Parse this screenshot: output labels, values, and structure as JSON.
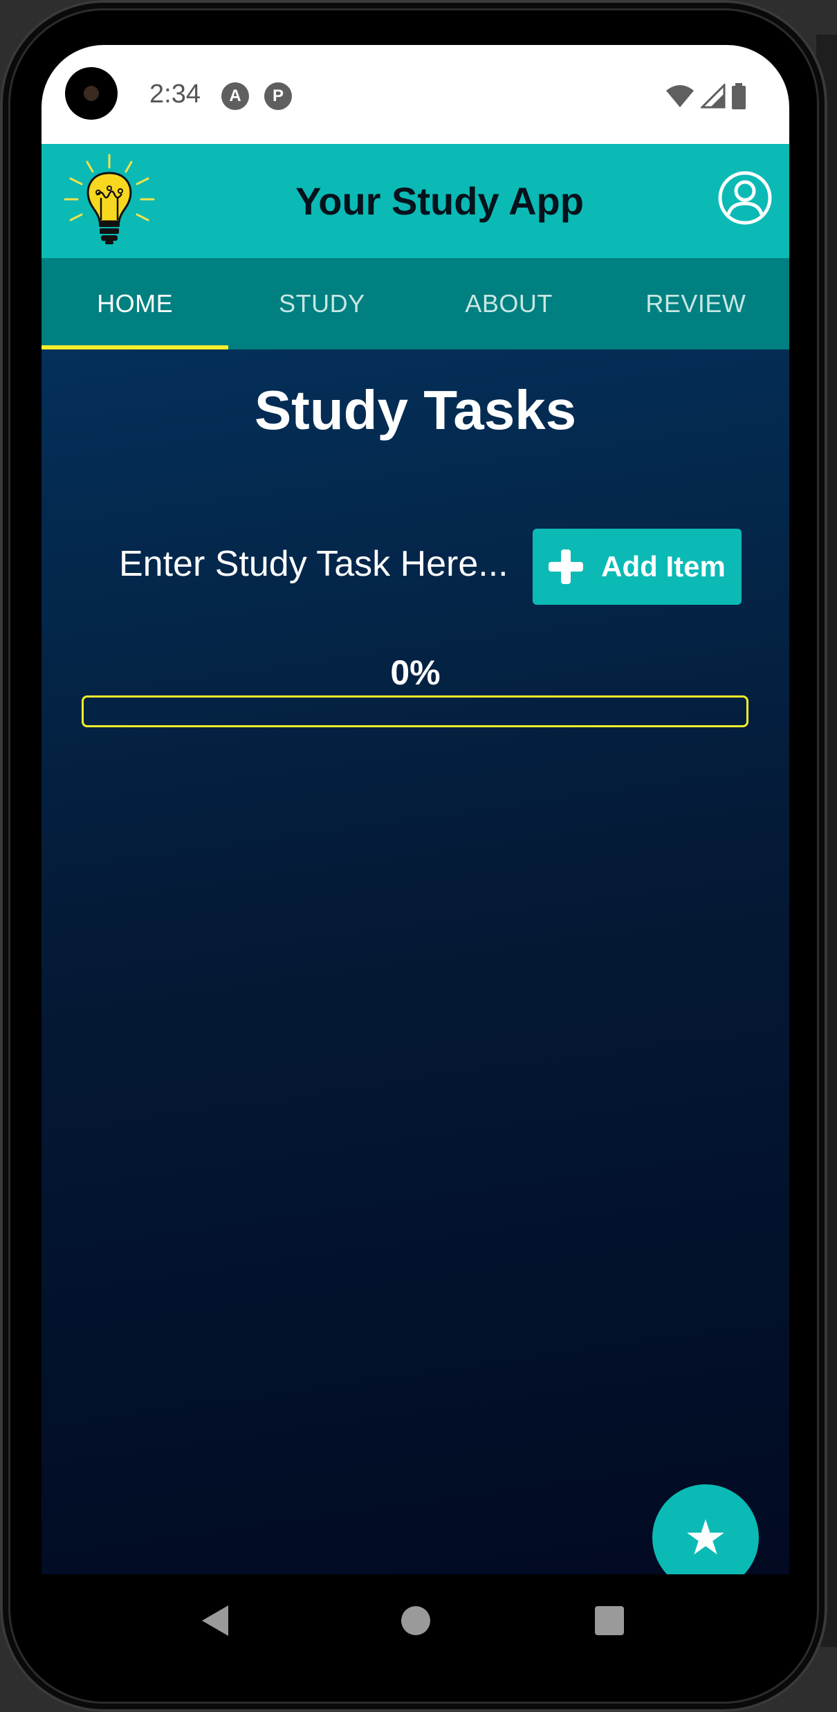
{
  "status_bar": {
    "time": "2:34",
    "indicators": [
      "A",
      "P"
    ],
    "right_icons": [
      "wifi-icon",
      "cell-signal-icon",
      "battery-icon"
    ]
  },
  "app_bar": {
    "title": "Your Study App",
    "logo_icon": "lightbulb-icon",
    "profile_icon": "account-circle-icon",
    "accent_color": "#0bbab5"
  },
  "tabs": [
    {
      "label": "HOME",
      "active": true
    },
    {
      "label": "STUDY",
      "active": false
    },
    {
      "label": "ABOUT",
      "active": false
    },
    {
      "label": "REVIEW",
      "active": false
    }
  ],
  "main": {
    "title": "Study Tasks",
    "input": {
      "placeholder": "Enter Study Task Here...",
      "value": ""
    },
    "add_button": {
      "label": "Add Item",
      "icon": "plus-icon"
    },
    "progress": {
      "label": "0%",
      "value": 0,
      "color": "#f5f02a"
    }
  },
  "fab": {
    "icon": "star-icon",
    "glyph": "★"
  },
  "nav_bar": {
    "icons": [
      "back-icon",
      "home-icon",
      "recents-icon"
    ]
  }
}
